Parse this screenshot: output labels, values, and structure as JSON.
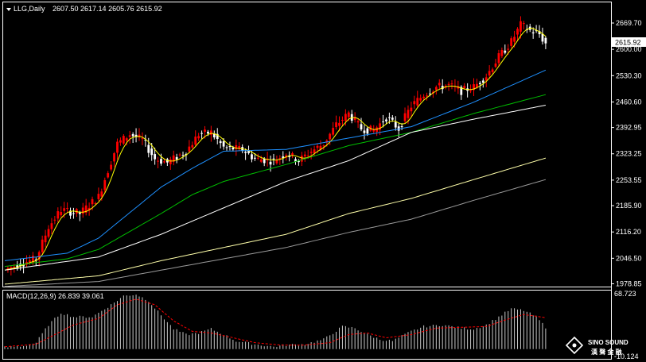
{
  "header": {
    "symbol": "LLG,Daily",
    "ohlc": "2607.50 2617.14 2605.76 2615.92",
    "price_tag": "2615.92"
  },
  "macd": {
    "label": "MACD(12,26,9) 26.839 39.061",
    "scale_top": "68.723",
    "scale_bottom": "-10.124"
  },
  "watermark": {
    "brand": "SINO SOUND",
    "cn": "漢 聲 金 融"
  },
  "colors": {
    "background": "#000000",
    "up_candle": "#ff0000",
    "down_candle": "#ffffff",
    "ma_fast": "#ffff00",
    "ma_mid": "#1e90ff",
    "ma_slow": "#00c000",
    "ma_100": "#ffffff",
    "ma_200": "#ffffaa",
    "ma_300": "#9a9a9a",
    "macd_hist": "#c8c8c8",
    "macd_signal": "#ff0000"
  },
  "chart_data": {
    "type": "candlestick",
    "y_ticks": [
      "2669.70",
      "2600.00",
      "2530.30",
      "2460.60",
      "2392.95",
      "2323.25",
      "2253.55",
      "2185.90",
      "2116.20",
      "2046.50",
      "1978.85"
    ],
    "ylim": [
      1975,
      2690
    ],
    "anchors": [
      [
        0,
        2015
      ],
      [
        4,
        2030
      ],
      [
        10,
        2045
      ],
      [
        14,
        2130
      ],
      [
        18,
        2175
      ],
      [
        24,
        2165
      ],
      [
        30,
        2210
      ],
      [
        36,
        2350
      ],
      [
        40,
        2375
      ],
      [
        44,
        2360
      ],
      [
        48,
        2310
      ],
      [
        52,
        2300
      ],
      [
        58,
        2330
      ],
      [
        62,
        2375
      ],
      [
        66,
        2380
      ],
      [
        70,
        2340
      ],
      [
        76,
        2335
      ],
      [
        80,
        2310
      ],
      [
        86,
        2305
      ],
      [
        90,
        2325
      ],
      [
        94,
        2305
      ],
      [
        98,
        2330
      ],
      [
        102,
        2350
      ],
      [
        106,
        2400
      ],
      [
        110,
        2430
      ],
      [
        114,
        2390
      ],
      [
        118,
        2385
      ],
      [
        122,
        2420
      ],
      [
        126,
        2390
      ],
      [
        130,
        2450
      ],
      [
        134,
        2480
      ],
      [
        138,
        2500
      ],
      [
        142,
        2505
      ],
      [
        146,
        2490
      ],
      [
        150,
        2500
      ],
      [
        154,
        2530
      ],
      [
        158,
        2580
      ],
      [
        162,
        2620
      ],
      [
        165,
        2665
      ],
      [
        168,
        2650
      ],
      [
        171,
        2640
      ],
      [
        173,
        2615
      ]
    ],
    "ma_anchors": {
      "ma_mid": [
        [
          0,
          2040
        ],
        [
          20,
          2060
        ],
        [
          30,
          2100
        ],
        [
          50,
          2235
        ],
        [
          60,
          2285
        ],
        [
          70,
          2330
        ],
        [
          90,
          2335
        ],
        [
          110,
          2365
        ],
        [
          130,
          2395
        ],
        [
          150,
          2460
        ],
        [
          173,
          2545
        ]
      ],
      "ma_slow": [
        [
          0,
          2025
        ],
        [
          20,
          2045
        ],
        [
          30,
          2070
        ],
        [
          50,
          2165
        ],
        [
          60,
          2215
        ],
        [
          70,
          2250
        ],
        [
          90,
          2295
        ],
        [
          110,
          2345
        ],
        [
          130,
          2380
        ],
        [
          150,
          2430
        ],
        [
          173,
          2480
        ]
      ],
      "ma_100": [
        [
          0,
          2015
        ],
        [
          30,
          2050
        ],
        [
          50,
          2110
        ],
        [
          70,
          2180
        ],
        [
          90,
          2250
        ],
        [
          110,
          2305
        ],
        [
          130,
          2380
        ],
        [
          150,
          2415
        ],
        [
          173,
          2452
        ]
      ],
      "ma_200": [
        [
          0,
          1978
        ],
        [
          30,
          2000
        ],
        [
          50,
          2040
        ],
        [
          70,
          2075
        ],
        [
          90,
          2110
        ],
        [
          110,
          2165
        ],
        [
          130,
          2205
        ],
        [
          150,
          2255
        ],
        [
          173,
          2312
        ]
      ],
      "ma_300": [
        [
          0,
          1972
        ],
        [
          30,
          1985
        ],
        [
          50,
          2015
        ],
        [
          70,
          2045
        ],
        [
          90,
          2075
        ],
        [
          110,
          2115
        ],
        [
          130,
          2150
        ],
        [
          150,
          2200
        ],
        [
          173,
          2255
        ]
      ]
    },
    "macd_hist_anchors": [
      [
        0,
        2
      ],
      [
        6,
        4
      ],
      [
        10,
        8
      ],
      [
        14,
        30
      ],
      [
        18,
        45
      ],
      [
        22,
        40
      ],
      [
        28,
        40
      ],
      [
        34,
        55
      ],
      [
        38,
        66
      ],
      [
        42,
        68
      ],
      [
        46,
        60
      ],
      [
        50,
        42
      ],
      [
        54,
        25
      ],
      [
        58,
        18
      ],
      [
        62,
        20
      ],
      [
        66,
        25
      ],
      [
        70,
        18
      ],
      [
        74,
        10
      ],
      [
        80,
        6
      ],
      [
        86,
        3
      ],
      [
        90,
        5
      ],
      [
        96,
        6
      ],
      [
        102,
        12
      ],
      [
        108,
        28
      ],
      [
        112,
        26
      ],
      [
        116,
        18
      ],
      [
        120,
        12
      ],
      [
        124,
        10
      ],
      [
        130,
        22
      ],
      [
        134,
        28
      ],
      [
        140,
        30
      ],
      [
        146,
        26
      ],
      [
        150,
        25
      ],
      [
        154,
        30
      ],
      [
        158,
        40
      ],
      [
        162,
        50
      ],
      [
        166,
        48
      ],
      [
        170,
        40
      ],
      [
        173,
        27
      ]
    ],
    "macd_signal_anchors": [
      [
        0,
        3
      ],
      [
        10,
        6
      ],
      [
        16,
        18
      ],
      [
        22,
        30
      ],
      [
        30,
        38
      ],
      [
        36,
        55
      ],
      [
        42,
        62
      ],
      [
        48,
        55
      ],
      [
        54,
        35
      ],
      [
        60,
        22
      ],
      [
        66,
        20
      ],
      [
        72,
        15
      ],
      [
        80,
        8
      ],
      [
        88,
        5
      ],
      [
        96,
        5
      ],
      [
        104,
        8
      ],
      [
        110,
        18
      ],
      [
        116,
        20
      ],
      [
        122,
        14
      ],
      [
        130,
        18
      ],
      [
        138,
        26
      ],
      [
        146,
        27
      ],
      [
        154,
        28
      ],
      [
        160,
        36
      ],
      [
        166,
        43
      ],
      [
        173,
        39
      ]
    ]
  }
}
